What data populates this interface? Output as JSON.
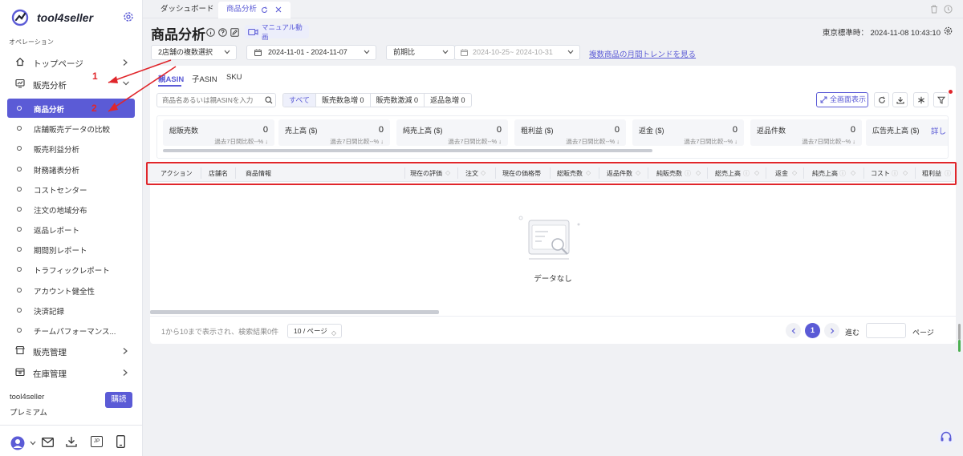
{
  "app": {
    "name": "tool4seller"
  },
  "sidebar": {
    "section_label": "オペレーション",
    "top_items": [
      {
        "label": "トップページ",
        "icon": "home-icon"
      },
      {
        "label": "販売分析",
        "icon": "chart-icon"
      }
    ],
    "sub_items": [
      {
        "label": "商品分析",
        "active": true
      },
      {
        "label": "店舗販売データの比較"
      },
      {
        "label": "販売利益分析"
      },
      {
        "label": "財務諸表分析"
      },
      {
        "label": "コストセンター"
      },
      {
        "label": "注文の地域分布"
      },
      {
        "label": "返品レポート"
      },
      {
        "label": "期間別レポート"
      },
      {
        "label": "トラフィックレポート"
      },
      {
        "label": "アカウント健全性"
      },
      {
        "label": "決済記録"
      },
      {
        "label": "チームパフォーマンス..."
      }
    ],
    "bottom_items": [
      {
        "label": "販売管理",
        "icon": "store-icon"
      },
      {
        "label": "在庫管理",
        "icon": "inventory-icon"
      }
    ],
    "plan": {
      "name": "tool4seller",
      "level": "プレミアム",
      "buy_label": "購読"
    },
    "footer_badge": "JP"
  },
  "tabs": [
    {
      "label": "ダッシュボード"
    },
    {
      "label": "商品分析",
      "active": true
    }
  ],
  "page": {
    "title": "商品分析",
    "manual_label": "マニュアル動画",
    "timezone": "東京標準時： 2024-11-08 10:43:10"
  },
  "filters": {
    "store_select": "2店舗の複数選択",
    "date_range": "2024-11-01 - 2024-11-07",
    "compare": "前期比",
    "compare_range": "2024-10-25~ 2024-10-31",
    "trend_link": "複数商品の月間トレンドを見る"
  },
  "sub_tabs": [
    "親ASIN",
    "子ASIN",
    "SKU"
  ],
  "search": {
    "placeholder": "商品名あるいは親ASINを入力"
  },
  "quick_filters": [
    {
      "label": "すべて",
      "active": true
    },
    {
      "label": "販売数急増 0"
    },
    {
      "label": "販売数激減 0"
    },
    {
      "label": "返品急増 0"
    }
  ],
  "fullscreen_label": "全画面表示",
  "metrics": [
    {
      "label": "総販売数",
      "value": "0",
      "sub": "過去7日間比較--% ↓"
    },
    {
      "label": "売上高 ($)",
      "value": "0",
      "sub": "過去7日間比較--% ↓"
    },
    {
      "label": "純売上高 ($)",
      "value": "0",
      "sub": "過去7日間比較--% ↓"
    },
    {
      "label": "粗利益 ($)",
      "value": "0",
      "sub": "過去7日間比較--% ↓"
    },
    {
      "label": "返金 ($)",
      "value": "0",
      "sub": "過去7日間比較--% ↓"
    },
    {
      "label": "返品件数",
      "value": "0",
      "sub": "過去7日間比較--% ↓"
    },
    {
      "label": "広告売上高 ($)",
      "value": "",
      "sub": ""
    }
  ],
  "metrics_more": "詳し",
  "table": {
    "columns": [
      "アクション",
      "店舗名",
      "商品情報",
      "現在の評価",
      "注文",
      "現在の価格帯",
      "総販売数",
      "返品件数",
      "純販売数",
      "総売上高",
      "返金",
      "純売上高",
      "コスト",
      "粗利益"
    ],
    "empty_text": "データなし"
  },
  "pagination": {
    "summary": "1から10まで表示され、検索結果0件",
    "page_size": "10 / ページ",
    "current": "1",
    "goto_label": "進む",
    "page_label": "ページ"
  },
  "annotations": [
    "1",
    "2"
  ],
  "colors": {
    "accent": "#5b5bd6",
    "highlight": "#e0262b"
  }
}
